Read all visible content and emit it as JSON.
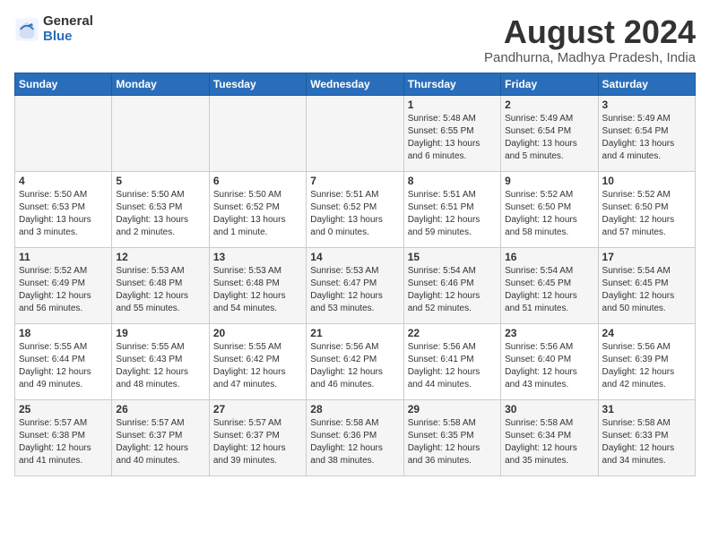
{
  "header": {
    "logo_general": "General",
    "logo_blue": "Blue",
    "month_title": "August 2024",
    "location": "Pandhurna, Madhya Pradesh, India"
  },
  "days_of_week": [
    "Sunday",
    "Monday",
    "Tuesday",
    "Wednesday",
    "Thursday",
    "Friday",
    "Saturday"
  ],
  "weeks": [
    [
      {
        "day": "",
        "info": ""
      },
      {
        "day": "",
        "info": ""
      },
      {
        "day": "",
        "info": ""
      },
      {
        "day": "",
        "info": ""
      },
      {
        "day": "1",
        "info": "Sunrise: 5:48 AM\nSunset: 6:55 PM\nDaylight: 13 hours\nand 6 minutes."
      },
      {
        "day": "2",
        "info": "Sunrise: 5:49 AM\nSunset: 6:54 PM\nDaylight: 13 hours\nand 5 minutes."
      },
      {
        "day": "3",
        "info": "Sunrise: 5:49 AM\nSunset: 6:54 PM\nDaylight: 13 hours\nand 4 minutes."
      }
    ],
    [
      {
        "day": "4",
        "info": "Sunrise: 5:50 AM\nSunset: 6:53 PM\nDaylight: 13 hours\nand 3 minutes."
      },
      {
        "day": "5",
        "info": "Sunrise: 5:50 AM\nSunset: 6:53 PM\nDaylight: 13 hours\nand 2 minutes."
      },
      {
        "day": "6",
        "info": "Sunrise: 5:50 AM\nSunset: 6:52 PM\nDaylight: 13 hours\nand 1 minute."
      },
      {
        "day": "7",
        "info": "Sunrise: 5:51 AM\nSunset: 6:52 PM\nDaylight: 13 hours\nand 0 minutes."
      },
      {
        "day": "8",
        "info": "Sunrise: 5:51 AM\nSunset: 6:51 PM\nDaylight: 12 hours\nand 59 minutes."
      },
      {
        "day": "9",
        "info": "Sunrise: 5:52 AM\nSunset: 6:50 PM\nDaylight: 12 hours\nand 58 minutes."
      },
      {
        "day": "10",
        "info": "Sunrise: 5:52 AM\nSunset: 6:50 PM\nDaylight: 12 hours\nand 57 minutes."
      }
    ],
    [
      {
        "day": "11",
        "info": "Sunrise: 5:52 AM\nSunset: 6:49 PM\nDaylight: 12 hours\nand 56 minutes."
      },
      {
        "day": "12",
        "info": "Sunrise: 5:53 AM\nSunset: 6:48 PM\nDaylight: 12 hours\nand 55 minutes."
      },
      {
        "day": "13",
        "info": "Sunrise: 5:53 AM\nSunset: 6:48 PM\nDaylight: 12 hours\nand 54 minutes."
      },
      {
        "day": "14",
        "info": "Sunrise: 5:53 AM\nSunset: 6:47 PM\nDaylight: 12 hours\nand 53 minutes."
      },
      {
        "day": "15",
        "info": "Sunrise: 5:54 AM\nSunset: 6:46 PM\nDaylight: 12 hours\nand 52 minutes."
      },
      {
        "day": "16",
        "info": "Sunrise: 5:54 AM\nSunset: 6:45 PM\nDaylight: 12 hours\nand 51 minutes."
      },
      {
        "day": "17",
        "info": "Sunrise: 5:54 AM\nSunset: 6:45 PM\nDaylight: 12 hours\nand 50 minutes."
      }
    ],
    [
      {
        "day": "18",
        "info": "Sunrise: 5:55 AM\nSunset: 6:44 PM\nDaylight: 12 hours\nand 49 minutes."
      },
      {
        "day": "19",
        "info": "Sunrise: 5:55 AM\nSunset: 6:43 PM\nDaylight: 12 hours\nand 48 minutes."
      },
      {
        "day": "20",
        "info": "Sunrise: 5:55 AM\nSunset: 6:42 PM\nDaylight: 12 hours\nand 47 minutes."
      },
      {
        "day": "21",
        "info": "Sunrise: 5:56 AM\nSunset: 6:42 PM\nDaylight: 12 hours\nand 46 minutes."
      },
      {
        "day": "22",
        "info": "Sunrise: 5:56 AM\nSunset: 6:41 PM\nDaylight: 12 hours\nand 44 minutes."
      },
      {
        "day": "23",
        "info": "Sunrise: 5:56 AM\nSunset: 6:40 PM\nDaylight: 12 hours\nand 43 minutes."
      },
      {
        "day": "24",
        "info": "Sunrise: 5:56 AM\nSunset: 6:39 PM\nDaylight: 12 hours\nand 42 minutes."
      }
    ],
    [
      {
        "day": "25",
        "info": "Sunrise: 5:57 AM\nSunset: 6:38 PM\nDaylight: 12 hours\nand 41 minutes."
      },
      {
        "day": "26",
        "info": "Sunrise: 5:57 AM\nSunset: 6:37 PM\nDaylight: 12 hours\nand 40 minutes."
      },
      {
        "day": "27",
        "info": "Sunrise: 5:57 AM\nSunset: 6:37 PM\nDaylight: 12 hours\nand 39 minutes."
      },
      {
        "day": "28",
        "info": "Sunrise: 5:58 AM\nSunset: 6:36 PM\nDaylight: 12 hours\nand 38 minutes."
      },
      {
        "day": "29",
        "info": "Sunrise: 5:58 AM\nSunset: 6:35 PM\nDaylight: 12 hours\nand 36 minutes."
      },
      {
        "day": "30",
        "info": "Sunrise: 5:58 AM\nSunset: 6:34 PM\nDaylight: 12 hours\nand 35 minutes."
      },
      {
        "day": "31",
        "info": "Sunrise: 5:58 AM\nSunset: 6:33 PM\nDaylight: 12 hours\nand 34 minutes."
      }
    ]
  ]
}
